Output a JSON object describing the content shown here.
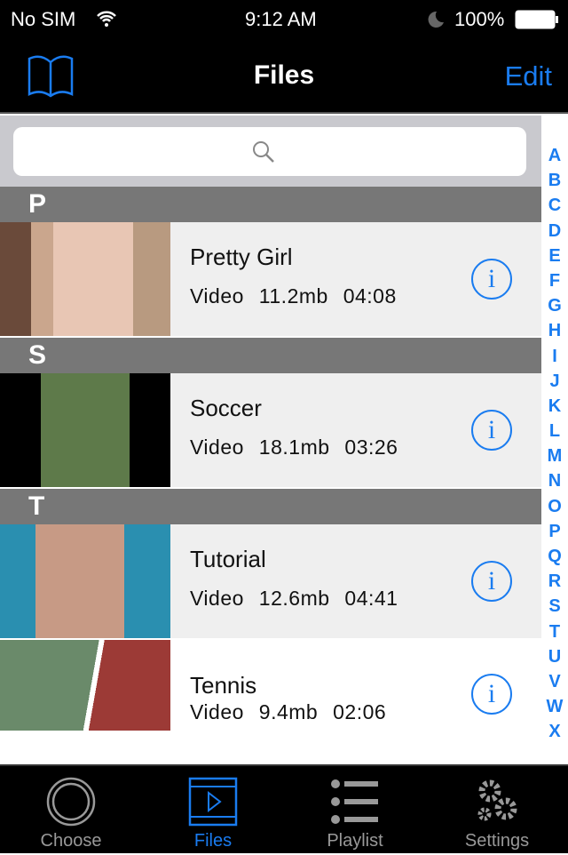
{
  "status": {
    "carrier": "No SIM",
    "time": "9:12 AM",
    "battery": "100%"
  },
  "nav": {
    "title": "Files",
    "edit": "Edit",
    "left_icon": "book-icon"
  },
  "search": {
    "placeholder": ""
  },
  "sections": [
    {
      "letter": "P",
      "items": [
        {
          "name": "Pretty Girl",
          "meta": "Video 11.2mb 04:08"
        }
      ]
    },
    {
      "letter": "S",
      "items": [
        {
          "name": "Soccer",
          "meta": "Video 18.1mb 03:26"
        }
      ]
    },
    {
      "letter": "T",
      "items": [
        {
          "name": "Tutorial",
          "meta": "Video 12.6mb 04:41"
        },
        {
          "name": "Tennis",
          "meta": "Video 9.4mb 02:06"
        }
      ]
    }
  ],
  "index": [
    "A",
    "B",
    "C",
    "D",
    "E",
    "F",
    "G",
    "H",
    "I",
    "J",
    "K",
    "L",
    "M",
    "N",
    "O",
    "P",
    "Q",
    "R",
    "S",
    "T",
    "U",
    "V",
    "W",
    "X"
  ],
  "tabs": [
    {
      "label": "Choose"
    },
    {
      "label": "Files"
    },
    {
      "label": "Playlist"
    },
    {
      "label": "Settings"
    }
  ],
  "colors": {
    "accent": "#1a7cf0",
    "section": "#777777",
    "row": "#efefef"
  }
}
